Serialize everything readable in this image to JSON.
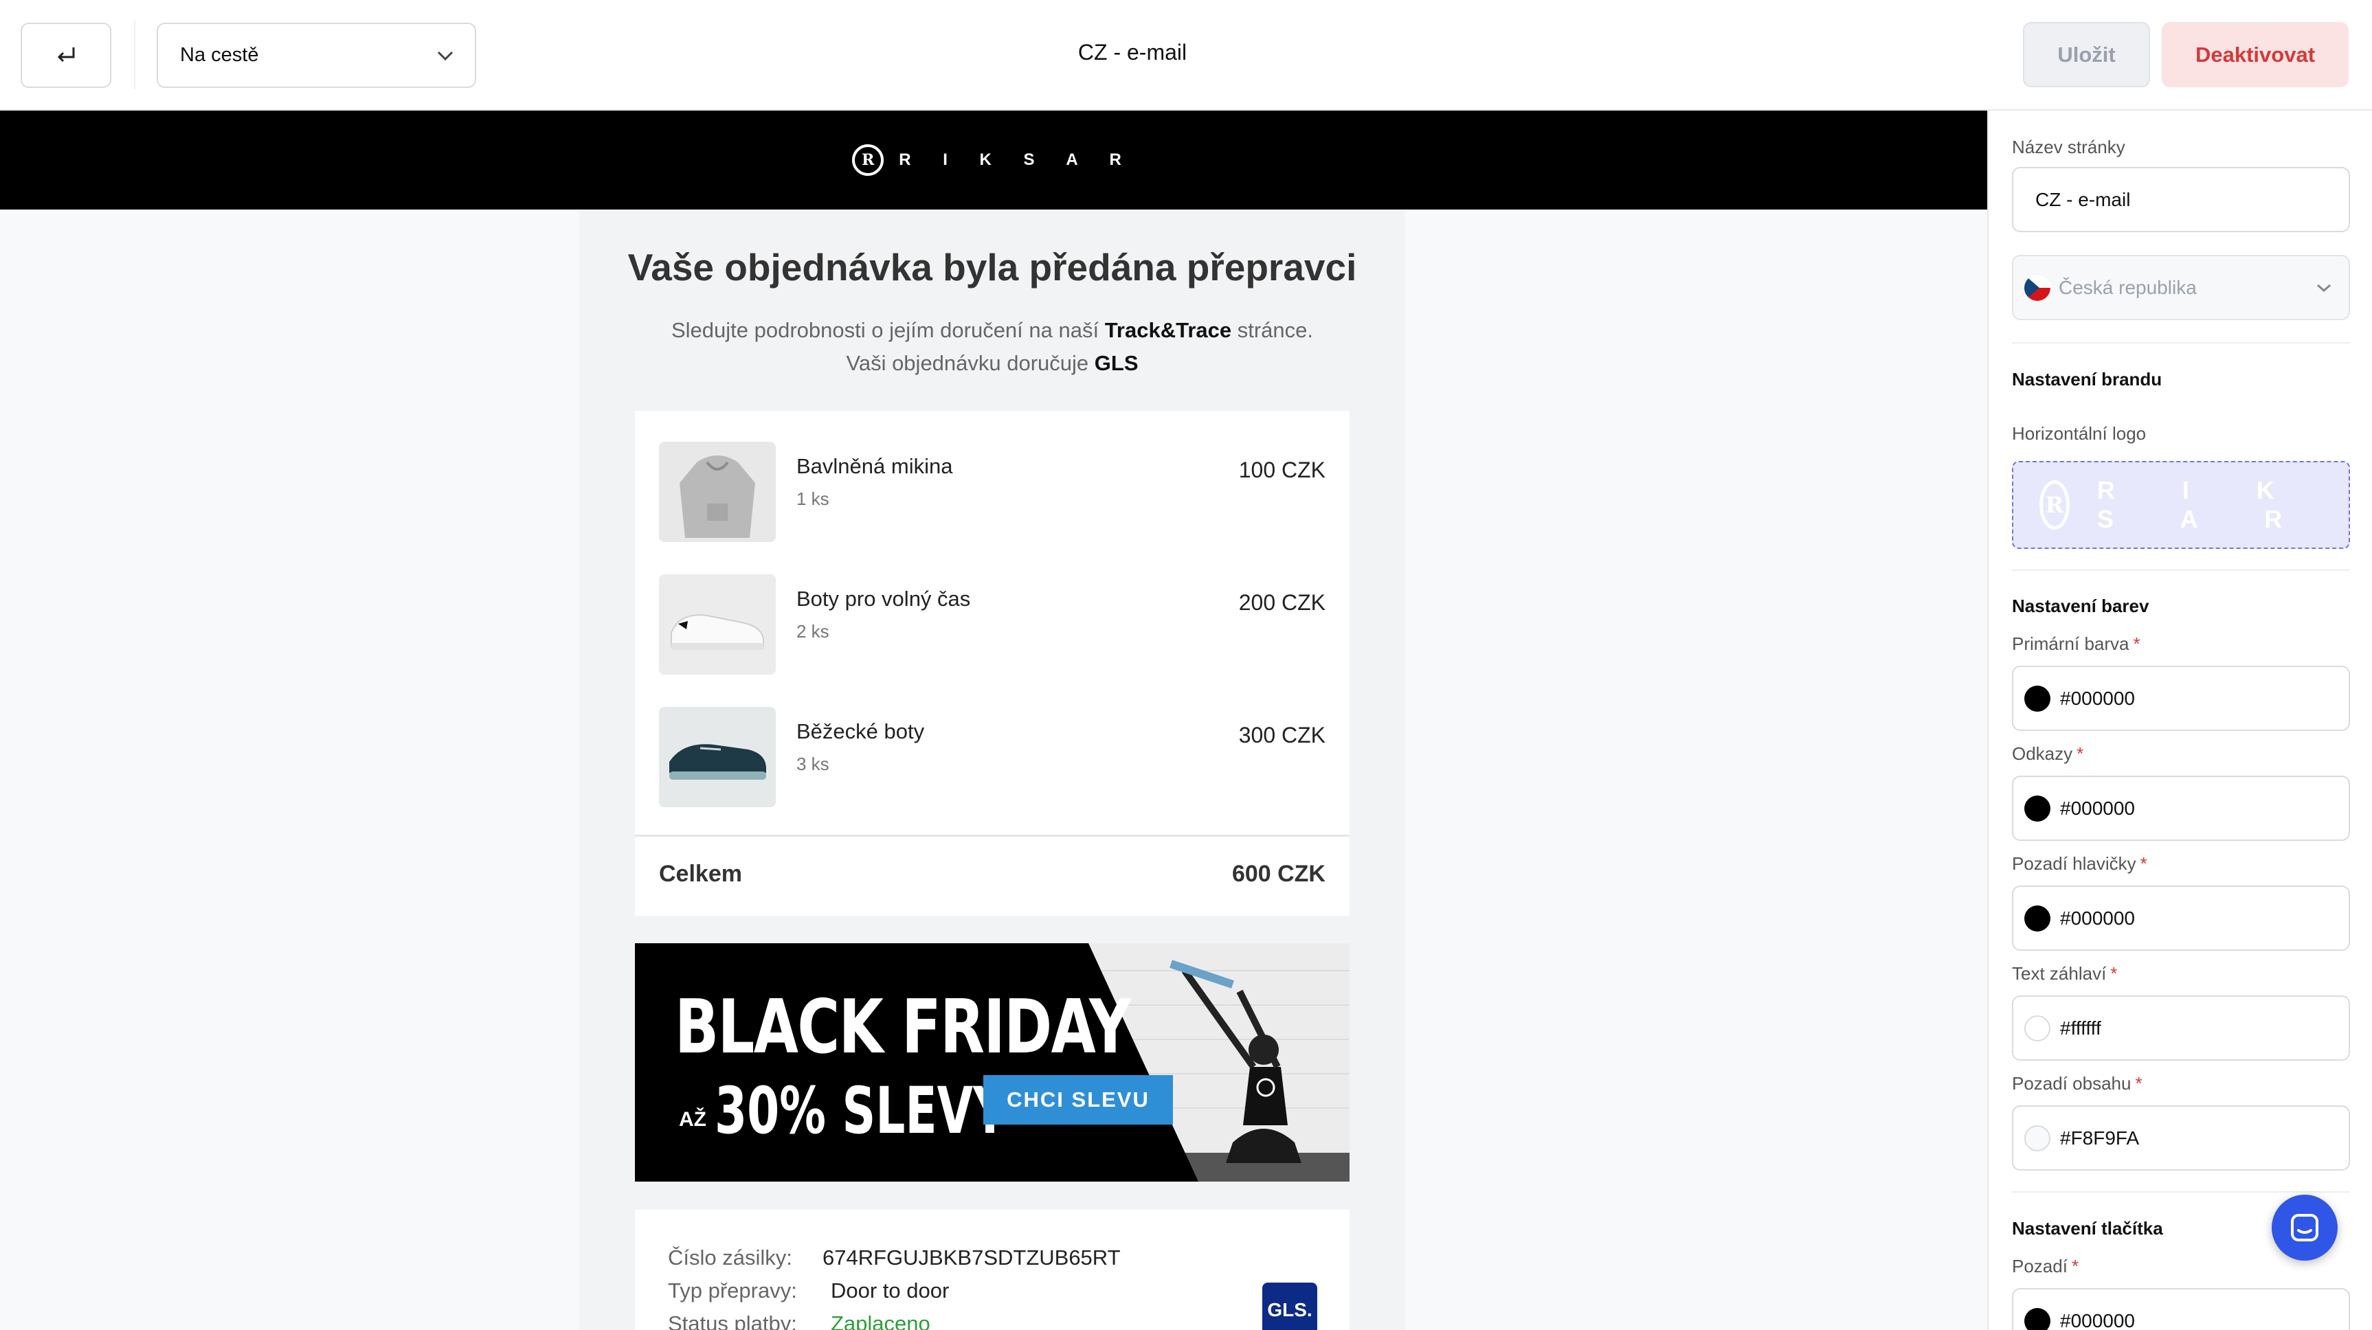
{
  "topbar": {
    "back_icon": "return-arrow-icon",
    "status_value": "Na cestě",
    "title": "CZ - e-mail",
    "save_label": "Uložit",
    "deactivate_label": "Deaktivovat"
  },
  "email": {
    "brand_word": "R I K S A R",
    "heading": "Vaše objednávka byla předána přepravci",
    "sub_line1_pre": "Sledujte podrobnosti o jejím doručení na naší ",
    "sub_line1_bold": "Track&Trace",
    "sub_line1_post": " stránce.",
    "sub_line2_pre": "Vaši objednávku doručuje ",
    "sub_line2_bold": "GLS",
    "items": [
      {
        "name": "Bavlněná mikina",
        "qty": "1 ks",
        "price": "100 CZK",
        "image": "hoodie"
      },
      {
        "name": "Boty pro volný čas",
        "qty": "2 ks",
        "price": "200 CZK",
        "image": "white-sneakers"
      },
      {
        "name": "Běžecké boty",
        "qty": "3 ks",
        "price": "300 CZK",
        "image": "running-shoes"
      }
    ],
    "total_label": "Celkem",
    "total_value": "600 CZK",
    "banner": {
      "title": "BLACK FRIDAY",
      "prefix": "AŽ",
      "discount": "30% SLEVY",
      "cta": "CHCI SLEVU"
    },
    "shipment": {
      "tracking_label": "Číslo zásilky:",
      "tracking_value": "674RFGUJBKB7SDTZUB65RT",
      "type_label": "Typ přepravy:",
      "type_value": "Door to door",
      "payment_label": "Status platby:",
      "payment_value": "Zaplaceno",
      "carrier_badge": "GLS."
    }
  },
  "panel": {
    "page_name_label": "Název stránky",
    "page_name_value": "CZ - e-mail",
    "country_value": "Česká republika",
    "brand_section": "Nastavení brandu",
    "logo_label": "Horizontální logo",
    "logo_word": "R I K S A R",
    "colors_section": "Nastavení barev",
    "colors": [
      {
        "label": "Primární barva",
        "value": "#000000",
        "swatch": "#000000"
      },
      {
        "label": "Odkazy",
        "value": "#000000",
        "swatch": "#000000"
      },
      {
        "label": "Pozadí hlavičky",
        "value": "#000000",
        "swatch": "#000000"
      },
      {
        "label": "Text záhlaví",
        "value": "#ffffff",
        "swatch": "#ffffff"
      },
      {
        "label": "Pozadí obsahu",
        "value": "#F8F9FA",
        "swatch": "#F8F9FA"
      }
    ],
    "button_section": "Nastavení tlačítka",
    "button_bg_label": "Pozadí",
    "button_bg_value": "#000000",
    "required_mark": "*"
  },
  "accent_colors": {
    "danger": "#d33a3a",
    "chat": "#2f56e6",
    "link_green": "#2e9e3a"
  }
}
